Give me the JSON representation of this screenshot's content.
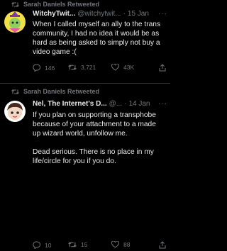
{
  "tweets": [
    {
      "retweeted_by": "Sarah Daniels Retweeted",
      "name": "WitchyTwit...",
      "handle": "@witchytwit...",
      "dot": "·",
      "date": "15 Jan",
      "more": "···",
      "body": [
        "When I called myself an ally to the trans community, I had no idea it would be as hard as being asked to simply not buy a video game :("
      ],
      "replies": "146",
      "retweets": "3,721",
      "likes": "43K"
    },
    {
      "retweeted_by": "Sarah Daniels Retweeted",
      "name": "Nel, The Internet's D...",
      "handle": "@...",
      "dot": "·",
      "date": "14 Jan",
      "more": "···",
      "body": [
        "If you plan on supporting a transphobe because of your attachment to a made up wizard world, unfollow me.",
        "Dead serious. There is no place in my life/circle for you if you do."
      ],
      "replies": "10",
      "retweets": "15",
      "likes": "88"
    }
  ],
  "icons": {
    "retweet": "retweet-icon",
    "reply": "reply-icon",
    "like": "heart-icon",
    "share": "share-icon"
  },
  "colors": {
    "background": "#000000",
    "text": "#e7e9ea",
    "muted": "#71767b",
    "separator": "#2f3336"
  }
}
